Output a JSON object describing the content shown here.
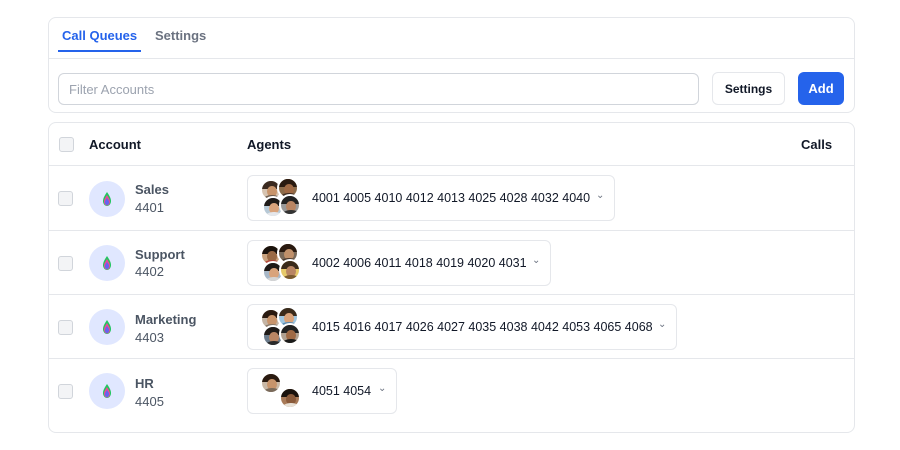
{
  "tabs": [
    {
      "label": "Call Queues",
      "active": true
    },
    {
      "label": "Settings",
      "active": false
    }
  ],
  "filter": {
    "placeholder": "Filter Accounts",
    "value": ""
  },
  "toolbar": {
    "settings_label": "Settings",
    "add_label": "Add"
  },
  "table": {
    "headers": {
      "account": "Account",
      "agents": "Agents",
      "calls": "Calls"
    },
    "rows": [
      {
        "name": "Sales",
        "number": "4401",
        "agents": "4001 4005 4010 4012 4013 4025 4028 4032 4040",
        "calls": ""
      },
      {
        "name": "Support",
        "number": "4402",
        "agents": "4002 4006 4011 4018 4019 4020 4031",
        "calls": ""
      },
      {
        "name": "Marketing",
        "number": "4403",
        "agents": "4015 4016 4017 4026 4027 4035 4038 4042 4053 4065 4068",
        "calls": ""
      },
      {
        "name": "HR",
        "number": "4405",
        "agents": "4051 4054",
        "calls": ""
      }
    ]
  },
  "icons": {
    "account_avatar": "colorful-flame-icon",
    "agents_dropdown": "chevron-down-icon",
    "agent_photos": "agent-avatar-photo"
  },
  "colors": {
    "accent": "#2563eb",
    "avatar_bg": "#e0e7ff",
    "border": "#e5e7eb"
  }
}
